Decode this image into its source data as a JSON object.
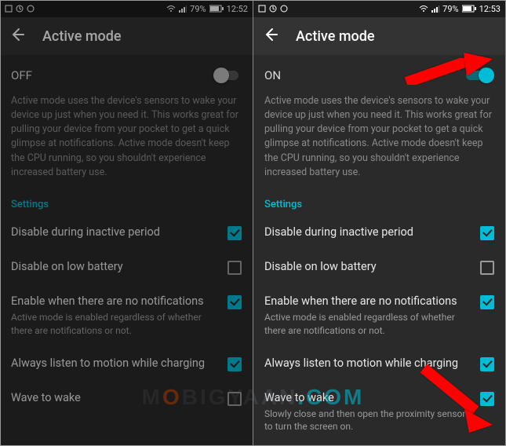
{
  "left": {
    "status": {
      "battery": "79%",
      "time": "12:52"
    },
    "header": {
      "title": "Active mode"
    },
    "toggle": {
      "label": "OFF",
      "on": false
    },
    "description": "Active mode uses the device's sensors to wake your device up just when you need it. This works great for pulling your device from your pocket to get a quick glimpse at notifications. Active mode doesn't keep the CPU running, so you shouldn't experience increased battery use.",
    "sectionLabel": "Settings",
    "settings": [
      {
        "label": "Disable during inactive period",
        "sub": "",
        "checked": true
      },
      {
        "label": "Disable on low battery",
        "sub": "",
        "checked": false
      },
      {
        "label": "Enable when there are no notifications",
        "sub": "Active mode is enabled regardless of whether there are notifications or not.",
        "checked": true
      },
      {
        "label": "Always listen to motion while charging",
        "sub": "",
        "checked": true
      },
      {
        "label": "Wave to wake",
        "sub": "",
        "checked": false
      }
    ]
  },
  "right": {
    "status": {
      "battery": "79%",
      "time": "12:53"
    },
    "header": {
      "title": "Active mode"
    },
    "toggle": {
      "label": "ON",
      "on": true
    },
    "description": "Active mode uses the device's sensors to wake your device up just when you need it. This works great for pulling your device from your pocket to get a quick glimpse at notifications. Active mode doesn't keep the CPU running, so you shouldn't experience increased battery use.",
    "sectionLabel": "Settings",
    "settings": [
      {
        "label": "Disable during inactive period",
        "sub": "",
        "checked": true
      },
      {
        "label": "Disable on low battery",
        "sub": "",
        "checked": false
      },
      {
        "label": "Enable when there are no notifications",
        "sub": "Active mode is enabled regardless of whether there are notifications or not.",
        "checked": true
      },
      {
        "label": "Always listen to motion while charging",
        "sub": "",
        "checked": true
      },
      {
        "label": "Wave to wake",
        "sub": "Slowly close and then open the proximity sensor to turn the screen on.",
        "checked": true
      }
    ]
  },
  "watermark": {
    "t1": "M",
    "t2": "O",
    "t3": "BIGYAAN",
    "t4": ".COM"
  }
}
